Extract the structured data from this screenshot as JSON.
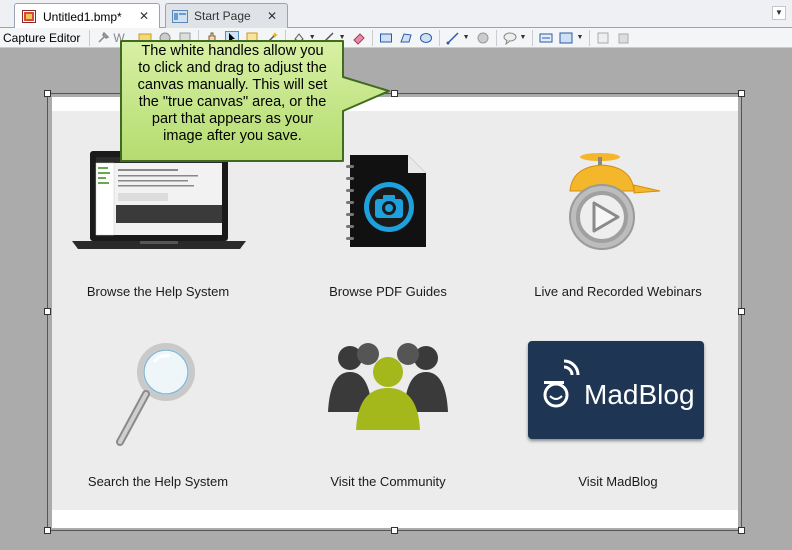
{
  "tabs": [
    {
      "label": "Untitled1.bmp*",
      "close": "✕",
      "active": true
    },
    {
      "label": "Start Page",
      "close": "✕",
      "active": false
    }
  ],
  "toolbar": {
    "label": "Capture Editor",
    "partial_text": "W"
  },
  "callout": {
    "lines": [
      "The white handles allow you",
      "to click and drag to adjust the",
      "canvas manually. This will set",
      "the \"true canvas\" area, or the",
      "part that appears as your",
      "image after you save."
    ],
    "fill": "#c5e68c",
    "border": "#3f6b1e"
  },
  "tiles": [
    {
      "label": "Browse the Help System",
      "icon": "laptop-icon"
    },
    {
      "label": "Browse PDF Guides",
      "icon": "pdf-notebook-icon"
    },
    {
      "label": "Live and Recorded Webinars",
      "icon": "webinar-play-icon"
    },
    {
      "label": "Search the Help System",
      "icon": "magnifier-icon"
    },
    {
      "label": "Visit the Community",
      "icon": "community-people-icon"
    },
    {
      "label": "Visit MadBlog",
      "icon": "madblog-logo",
      "logo_text": "MadBlog"
    }
  ],
  "colors": {
    "panel": "#ececec",
    "madblog_bg": "#1e3553",
    "community_green": "#a4b81c",
    "webinar_cap": "#f4b62a",
    "pdf_blue": "#1ea0dc"
  }
}
